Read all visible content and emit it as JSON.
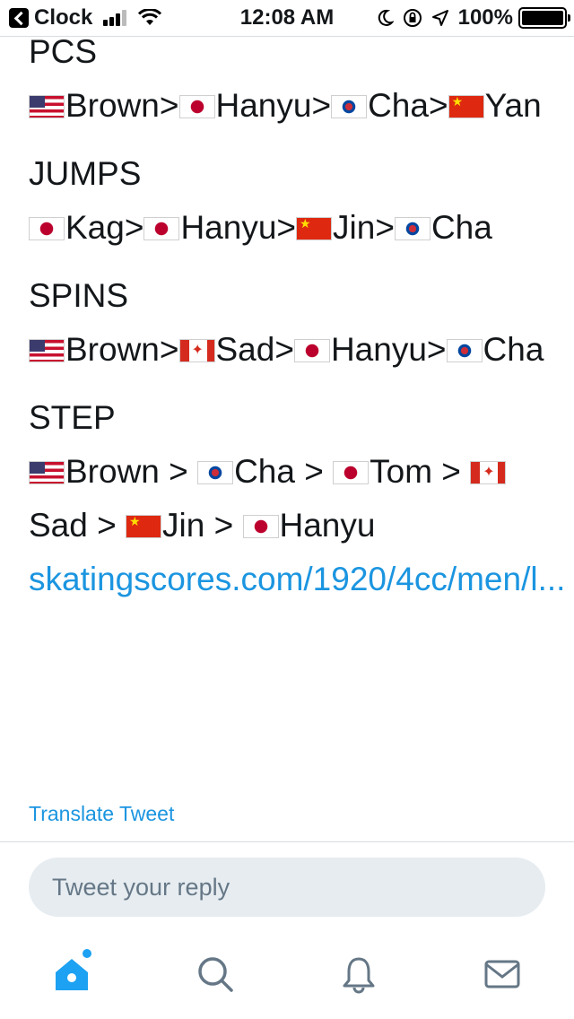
{
  "status_bar": {
    "back_app": "Clock",
    "time": "12:08 AM",
    "battery": "100%"
  },
  "tweet": {
    "sections": [
      {
        "title": "PCS",
        "entries": [
          {
            "flag": "us",
            "name": "Brown",
            "sep": ">"
          },
          {
            "flag": "jp",
            "name": "Hanyu",
            "sep": ">"
          },
          {
            "flag": "kr",
            "name": "Cha",
            "sep": ">"
          },
          {
            "flag": "cn",
            "name": "Yan",
            "sep": ""
          }
        ]
      },
      {
        "title": "JUMPS",
        "entries": [
          {
            "flag": "jp",
            "name": "Kag",
            "sep": ">"
          },
          {
            "flag": "jp",
            "name": "Hanyu",
            "sep": ">"
          },
          {
            "flag": "cn",
            "name": "Jin",
            "sep": ">"
          },
          {
            "flag": "kr",
            "name": "Cha",
            "sep": ""
          }
        ]
      },
      {
        "title": "SPINS",
        "entries": [
          {
            "flag": "us",
            "name": "Brown",
            "sep": ">"
          },
          {
            "flag": "ca",
            "name": "Sad",
            "sep": ">"
          },
          {
            "flag": "jp",
            "name": "Hanyu",
            "sep": ">"
          },
          {
            "flag": "kr",
            "name": "Cha",
            "sep": ""
          }
        ]
      },
      {
        "title": "STEP",
        "entries": [
          {
            "flag": "us",
            "name": "Brown",
            "sep": " > "
          },
          {
            "flag": "kr",
            "name": "Cha",
            "sep": " > "
          },
          {
            "flag": "jp",
            "name": "Tom",
            "sep": " > "
          },
          {
            "flag": "ca",
            "name": "Sad",
            "sep": " > "
          },
          {
            "flag": "cn",
            "name": "Jin",
            "sep": " > "
          },
          {
            "flag": "jp",
            "name": "Hanyu",
            "sep": ""
          }
        ]
      }
    ],
    "link_text": "skatingscores.com/1920/4cc/men/l...",
    "translate_label": "Translate Tweet"
  },
  "reply": {
    "placeholder": "Tweet your reply"
  },
  "tabbar": {
    "items": [
      {
        "icon": "home-icon",
        "active": true
      },
      {
        "icon": "search-icon",
        "active": false
      },
      {
        "icon": "bell-icon",
        "active": false
      },
      {
        "icon": "mail-icon",
        "active": false
      }
    ]
  },
  "colors": {
    "accent": "#1da1f2",
    "link": "#1b95e0",
    "text": "#14171a",
    "muted": "#657786",
    "reply_bg": "#e6ecf0"
  }
}
